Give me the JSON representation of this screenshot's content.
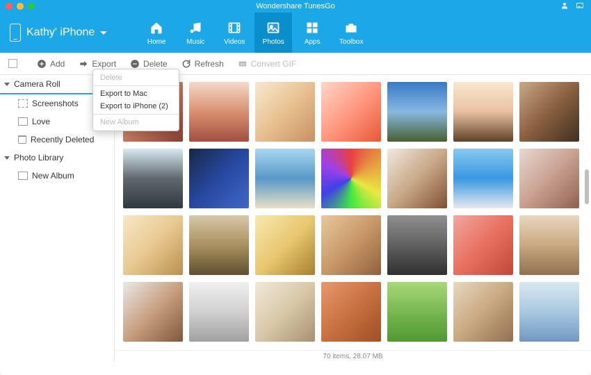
{
  "app": {
    "title": "Wondershare TunesGo"
  },
  "device": {
    "name": "Kathy' iPhone"
  },
  "nav": {
    "items": [
      {
        "label": "Home"
      },
      {
        "label": "Music"
      },
      {
        "label": "Videos"
      },
      {
        "label": "Photos",
        "active": true
      },
      {
        "label": "Apps"
      },
      {
        "label": "Toolbox"
      }
    ]
  },
  "toolbar": {
    "add": "Add",
    "export": "Export",
    "delete": "Delete",
    "refresh": "Refresh",
    "convert_gif": "Convert GIF"
  },
  "sidebar": {
    "groups": [
      {
        "label": "Camera Roll",
        "selected": true,
        "children": [
          {
            "label": "Screenshots"
          },
          {
            "label": "Love"
          },
          {
            "label": "Recently Deleted"
          }
        ]
      },
      {
        "label": "Photo Library",
        "children": [
          {
            "label": "New Album"
          }
        ]
      }
    ]
  },
  "context_menu": {
    "items": [
      {
        "label": "Delete",
        "disabled": true
      },
      {
        "sep": true
      },
      {
        "label": "Export to Mac"
      },
      {
        "label": "Export to iPhone (2)"
      },
      {
        "sep": true
      },
      {
        "label": "New Album",
        "disabled": true
      }
    ]
  },
  "status": {
    "text": "70 items, 28.07 MB"
  }
}
